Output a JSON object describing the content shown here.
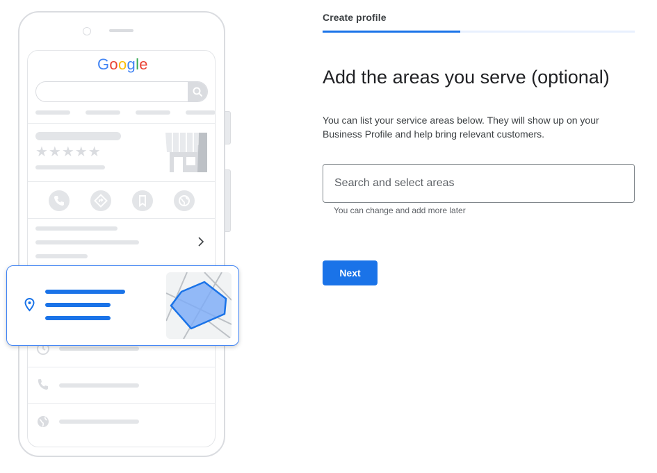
{
  "illustration": {
    "google_logo": {
      "letters": [
        "G",
        "o",
        "o",
        "g",
        "l",
        "e"
      ],
      "colors": [
        "#4285F4",
        "#EA4335",
        "#FBBC05",
        "#4285F4",
        "#34A853",
        "#EA4335"
      ]
    },
    "rating_stars": "★★★★★",
    "icons": [
      "search-icon",
      "storefront-icon",
      "phone-icon",
      "directions-icon",
      "bookmark-icon",
      "globe-icon",
      "chevron-right-icon",
      "location-pin-icon",
      "clock-icon",
      "map-icon"
    ],
    "accent_color": "#1a73e8"
  },
  "header": {
    "step_label": "Create profile",
    "progress": 0.44
  },
  "main": {
    "title": "Add the areas you serve (optional)",
    "description": "You can list your service areas below. They will show up on your Business Profile and help bring relevant customers.",
    "search": {
      "placeholder": "Search and select areas",
      "value": "",
      "helper_text": "You can change and add more later"
    },
    "next_label": "Next"
  }
}
